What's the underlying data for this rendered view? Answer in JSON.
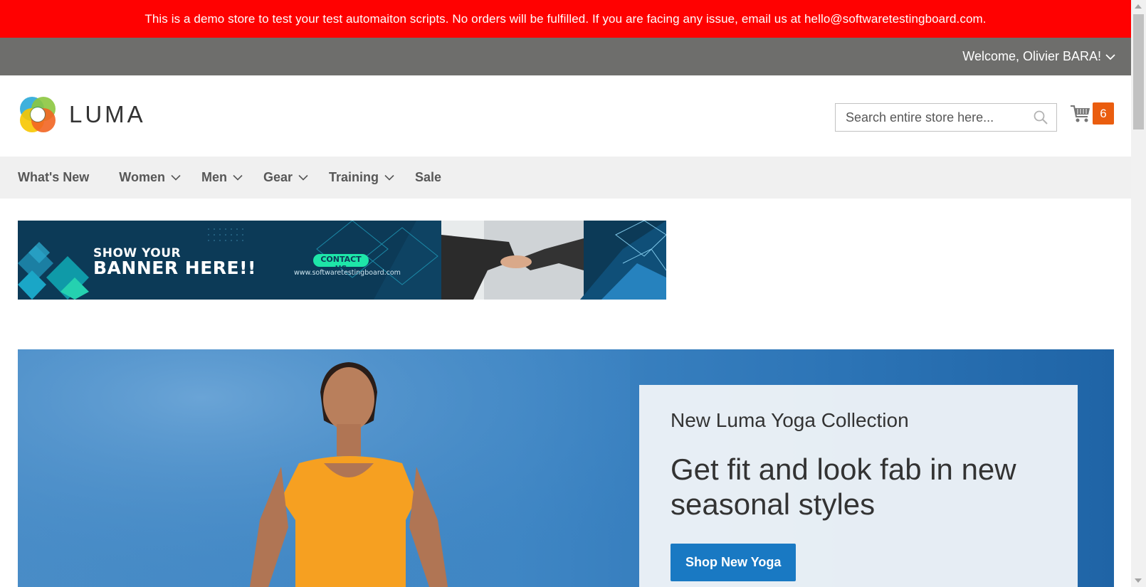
{
  "notice": {
    "text": "This is a demo store to test your test automaiton scripts. No orders will be fulfilled. If you are facing any issue, email us at hello@softwaretestingboard.com."
  },
  "topbar": {
    "welcome": "Welcome, Olivier BARA!"
  },
  "header": {
    "logo_text": "LUMA",
    "search_placeholder": "Search entire store here...",
    "cart_count": "6"
  },
  "nav": {
    "items": [
      {
        "label": "What's New",
        "has_dropdown": false
      },
      {
        "label": "Women",
        "has_dropdown": true
      },
      {
        "label": "Men",
        "has_dropdown": true
      },
      {
        "label": "Gear",
        "has_dropdown": true
      },
      {
        "label": "Training",
        "has_dropdown": true
      },
      {
        "label": "Sale",
        "has_dropdown": false
      }
    ]
  },
  "promo_banner": {
    "line1": "SHOW YOUR",
    "line2": "BANNER HERE!!",
    "contact": "CONTACT US",
    "url": "www.softwaretestingboard.com"
  },
  "hero": {
    "subtitle": "New Luma Yoga Collection",
    "title": "Get fit and look fab in new seasonal styles",
    "button": "Shop New Yoga"
  },
  "colors": {
    "notice_bg": "#ff0101",
    "topbar_bg": "#6e6e6c",
    "nav_bg": "#f0f0f0",
    "cart_badge": "#ea5d0f",
    "primary_button": "#1979c3"
  }
}
